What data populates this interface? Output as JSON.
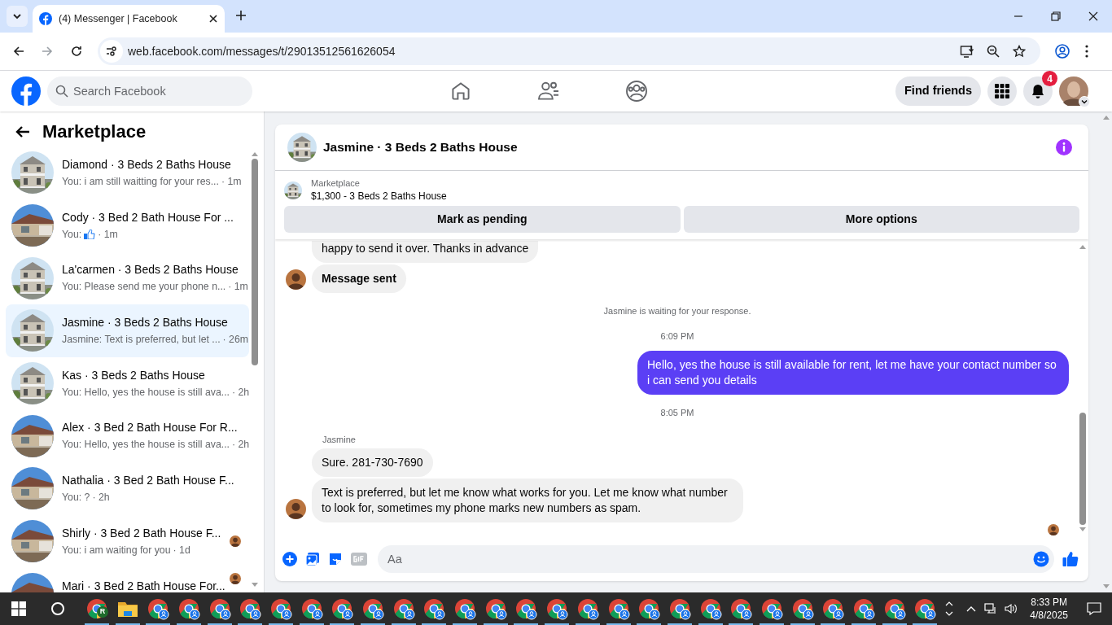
{
  "browser": {
    "tab_title": "(4) Messenger | Facebook",
    "url": "web.facebook.com/messages/t/29013512561626054"
  },
  "header": {
    "search_placeholder": "Search Facebook",
    "find_friends": "Find friends",
    "notification_count": "4"
  },
  "sidebar": {
    "title": "Marketplace",
    "conversations": [
      {
        "title": "Diamond · 3 Beds 2 Baths House",
        "preview": "You: i am still waitting for your res...",
        "time": "· 1m",
        "kind": "two-story",
        "like": false,
        "seen": false,
        "selected": false
      },
      {
        "title": "Cody · 3 Bed 2 Bath House For ...",
        "preview": "You:",
        "time": "· 1m",
        "kind": "ranch",
        "like": true,
        "seen": false,
        "selected": false
      },
      {
        "title": "La'carmen · 3 Beds 2 Baths House",
        "preview": "You: Please send me your phone n...",
        "time": "· 1m",
        "kind": "two-story",
        "like": false,
        "seen": false,
        "selected": false
      },
      {
        "title": "Jasmine · 3 Beds 2 Baths House",
        "preview": "Jasmine: Text is preferred, but let ...",
        "time": "· 26m",
        "kind": "two-story",
        "like": false,
        "seen": false,
        "selected": true
      },
      {
        "title": "Kas · 3 Beds 2 Baths House",
        "preview": "You: Hello, yes the house is still ava...",
        "time": "· 2h",
        "kind": "two-story",
        "like": false,
        "seen": false,
        "selected": false
      },
      {
        "title": "Alex · 3 Bed 2 Bath House For R...",
        "preview": "You: Hello, yes the house is still ava...",
        "time": "· 2h",
        "kind": "ranch",
        "like": false,
        "seen": false,
        "selected": false
      },
      {
        "title": "Nathalia · 3 Bed 2 Bath House F...",
        "preview": "You: ?",
        "time": "· 2h",
        "kind": "ranch",
        "like": false,
        "seen": false,
        "selected": false
      },
      {
        "title": "Shirly · 3 Bed 2 Bath House F...",
        "preview": "You: i am waiting for you",
        "time": "· 1d",
        "kind": "ranch",
        "like": false,
        "seen": true,
        "selected": false
      },
      {
        "title": "Mari · 3 Bed 2 Bath House For...",
        "kind": "ranch",
        "like": false,
        "seen": true,
        "selected": false
      }
    ]
  },
  "chat": {
    "title": "Jasmine · 3 Beds 2 Baths House",
    "listing": {
      "label": "Marketplace",
      "price_title": "$1,300 - 3 Beds 2 Baths House"
    },
    "actions": [
      "Mark as pending",
      "More options"
    ],
    "messages": [
      {
        "kind": "received",
        "text": "happy to send it over. Thanks in advance",
        "avatar": false,
        "bold": false
      },
      {
        "kind": "received",
        "text": "Message sent",
        "avatar": true,
        "bold": true
      },
      {
        "kind": "notice",
        "text": "Jasmine is waiting for your response."
      },
      {
        "kind": "time",
        "text": "6:09 PM"
      },
      {
        "kind": "sent",
        "text": "Hello, yes the house is still available for rent, let me have your contact number so i can send you  details"
      },
      {
        "kind": "time",
        "text": "8:05 PM"
      },
      {
        "kind": "sender",
        "text": "Jasmine"
      },
      {
        "kind": "received",
        "text": "Sure. 281-730-7690",
        "avatar": false,
        "bold": false
      },
      {
        "kind": "received",
        "text": "Text is preferred, but let me know what works for you. Let me know what number to look for, sometimes my phone marks new numbers as spam.",
        "avatar": true,
        "bold": false
      }
    ],
    "seen": true,
    "composer": {
      "placeholder": "Aa"
    }
  },
  "taskbar": {
    "apps": [
      {
        "kind": "chrome",
        "badge": "R"
      },
      {
        "kind": "folder"
      },
      {
        "kind": "chrome-profile"
      },
      {
        "kind": "chrome-profile"
      },
      {
        "kind": "chrome-profile"
      },
      {
        "kind": "chrome-profile"
      },
      {
        "kind": "chrome-profile"
      },
      {
        "kind": "chrome-profile"
      },
      {
        "kind": "chrome-profile"
      },
      {
        "kind": "chrome-profile"
      },
      {
        "kind": "chrome-profile"
      },
      {
        "kind": "chrome-profile"
      },
      {
        "kind": "chrome-profile"
      },
      {
        "kind": "chrome-profile"
      },
      {
        "kind": "chrome-profile"
      },
      {
        "kind": "chrome-profile"
      },
      {
        "kind": "chrome-profile"
      },
      {
        "kind": "chrome-profile"
      },
      {
        "kind": "chrome-profile"
      },
      {
        "kind": "chrome-profile"
      },
      {
        "kind": "chrome-profile"
      },
      {
        "kind": "chrome-profile"
      },
      {
        "kind": "chrome-profile"
      },
      {
        "kind": "chrome-profile"
      },
      {
        "kind": "chrome-profile"
      },
      {
        "kind": "chrome-profile"
      },
      {
        "kind": "chrome-profile"
      },
      {
        "kind": "chrome-profile"
      }
    ],
    "time": "8:33 PM",
    "date": "4/8/2025"
  }
}
